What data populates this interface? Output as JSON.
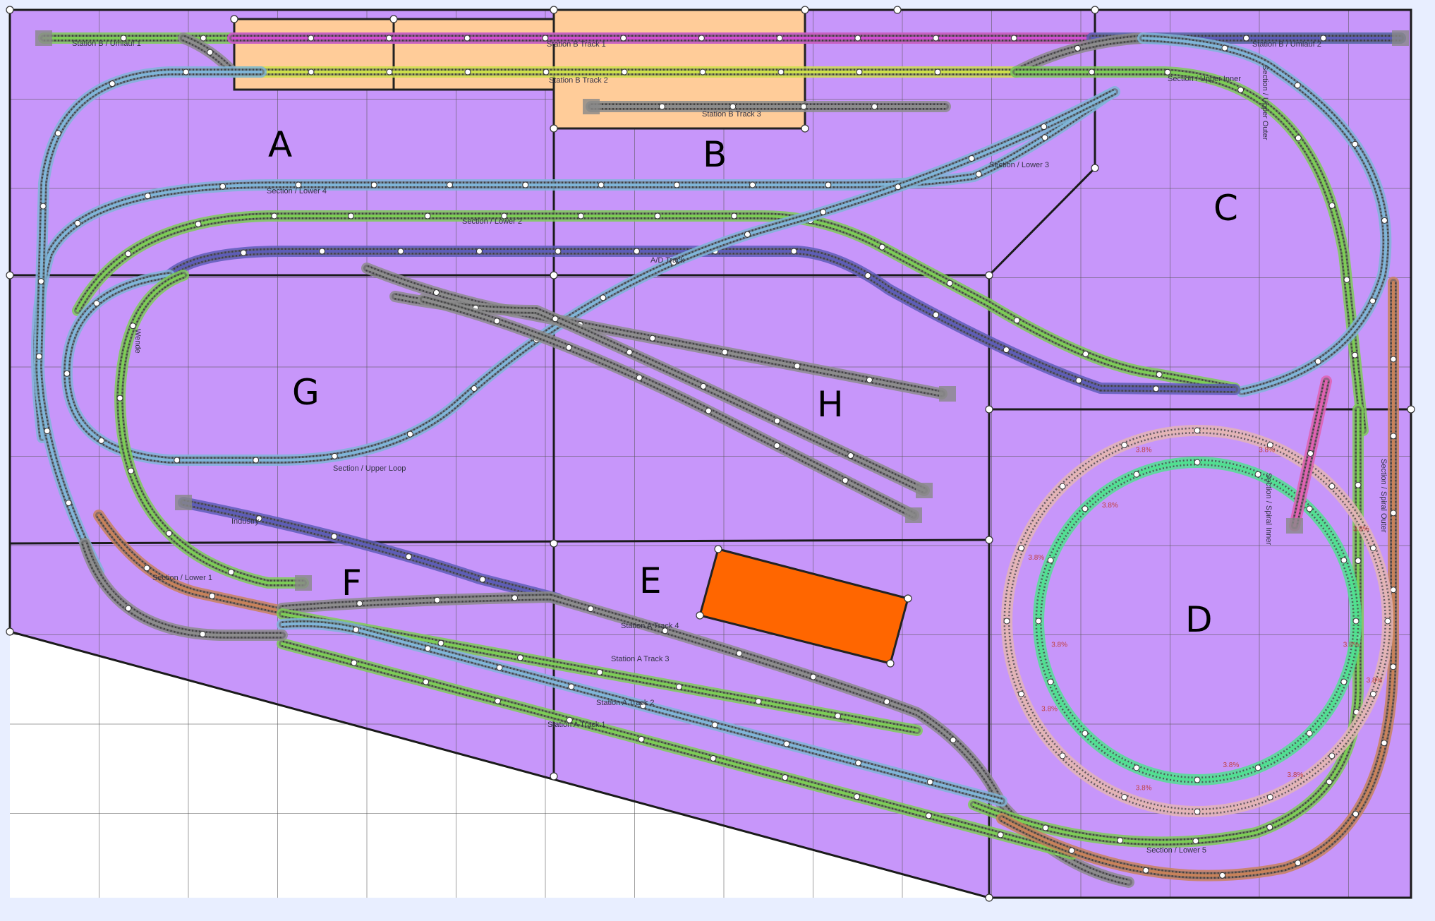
{
  "colors": {
    "background": "#e8eeff",
    "board": "#c796fa",
    "module_peach": "#ffcc99",
    "building_orange": "#ff6600",
    "track_green": "#7ccd55",
    "track_blue": "#7fb5d8",
    "track_gray": "#8c8c8c",
    "track_magenta": "#d24fd2",
    "track_yellow": "#cce04a",
    "track_navy": "#5d5db8",
    "track_rosy": "#e3b5b5",
    "track_brown": "#c8825a",
    "track_mint": "#50e090",
    "track_pink": "#e060b0"
  },
  "section_letters": [
    "A",
    "B",
    "C",
    "D",
    "E",
    "F",
    "G",
    "H"
  ],
  "track_labels": [
    "Station B / Umlauf 1",
    "Station B Track 1",
    "Station B / Umlauf 2",
    "Station B Track 2",
    "Section / Upper Inner",
    "Station B Track 3",
    "Section / Upper Outer",
    "Section / Lower 3",
    "Section / Lower 4",
    "Section / Lower 2",
    "A/D Track",
    "Section / Upper Loop",
    "Industry",
    "Section / Lower 1",
    "Station A Track 4",
    "Station A Track 3",
    "Station A Track 2",
    "Station A Track 1",
    "Section / Spiral Inner",
    "Section / Lower 5",
    "Section / Spiral Outer",
    "Wende"
  ],
  "grades": [
    "3.8%",
    "3.8%",
    "3.8%",
    "3.8%",
    "3.8%",
    "3.8%",
    "3.8%",
    "3.8%",
    "3.8%",
    "3.8%",
    "3.8%",
    "3.8%"
  ]
}
